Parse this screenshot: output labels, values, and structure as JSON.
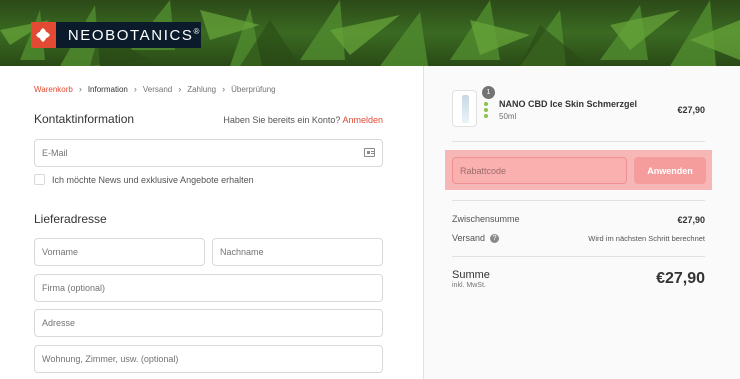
{
  "brand": {
    "name": "NEOBOTANICS",
    "mark": "®",
    "logo_color": "#e24a33"
  },
  "breadcrumb": [
    {
      "label": "Warenkorb",
      "state": "link"
    },
    {
      "label": "Information",
      "state": "current"
    },
    {
      "label": "Versand",
      "state": "inactive"
    },
    {
      "label": "Zahlung",
      "state": "inactive"
    },
    {
      "label": "Überprüfung",
      "state": "inactive"
    }
  ],
  "contact": {
    "title": "Kontaktinformation",
    "login_hint": "Haben Sie bereits ein Konto?",
    "login_link": "Anmelden",
    "email_placeholder": "E-Mail",
    "newsletter_label": "Ich möchte News und exklusive Angebote erhalten"
  },
  "shipping": {
    "title": "Lieferadresse",
    "first_name_placeholder": "Vorname",
    "last_name_placeholder": "Nachname",
    "company_placeholder": "Firma (optional)",
    "address_placeholder": "Adresse",
    "apartment_placeholder": "Wohnung, Zimmer, usw. (optional)"
  },
  "order": {
    "product": {
      "name": "NANO CBD Ice Skin Schmerzgel",
      "variant": "50ml",
      "price": "€27,90",
      "quantity": "1"
    },
    "discount": {
      "placeholder": "Rabattcode",
      "button": "Anwenden"
    },
    "subtotal_label": "Zwischensumme",
    "subtotal_value": "€27,90",
    "shipping_label": "Versand",
    "shipping_value": "Wird im nächsten Schritt berechnet",
    "total_label": "Summe",
    "total_sub": "inkl. MwSt.",
    "total_value": "€27,90"
  },
  "colors": {
    "accent": "#e24a33",
    "highlight": "#f7b7b7"
  }
}
